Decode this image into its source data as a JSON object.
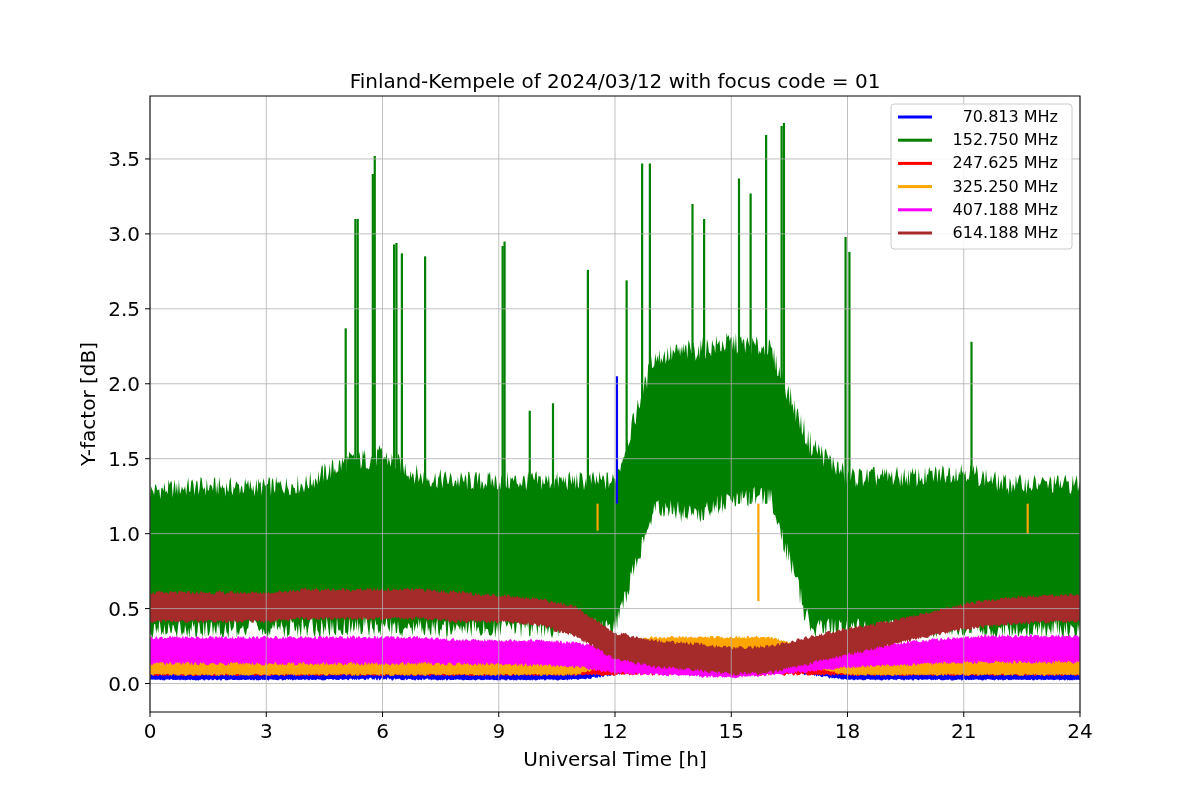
{
  "figure": {
    "title": "Finland-Kempele of 2024/03/12 with focus code = 01",
    "grid": true,
    "x_axis": {
      "label": "Universal Time [h]",
      "tick_labels": [
        "0",
        "3",
        "6",
        "9",
        "12",
        "15",
        "18",
        "21",
        "24"
      ]
    },
    "y_axis": {
      "label": "Y-factor [dB]",
      "tick_labels": [
        "3.5",
        "3.0",
        "2.5",
        "2.0",
        "1.5",
        "1.0",
        "0.5",
        "0.0"
      ]
    },
    "legend": [
      {
        "name": "70.813 MHz",
        "color": "#0000ff"
      },
      {
        "name": "152.750 MHz",
        "color": "#008000"
      },
      {
        "name": "247.625 MHz",
        "color": "#ff0000"
      },
      {
        "name": "325.250 MHz",
        "color": "#ffa500"
      },
      {
        "name": "407.188 MHz",
        "color": "#ff00ff"
      },
      {
        "name": "614.188 MHz",
        "color": "#a52a2a"
      }
    ]
  }
}
